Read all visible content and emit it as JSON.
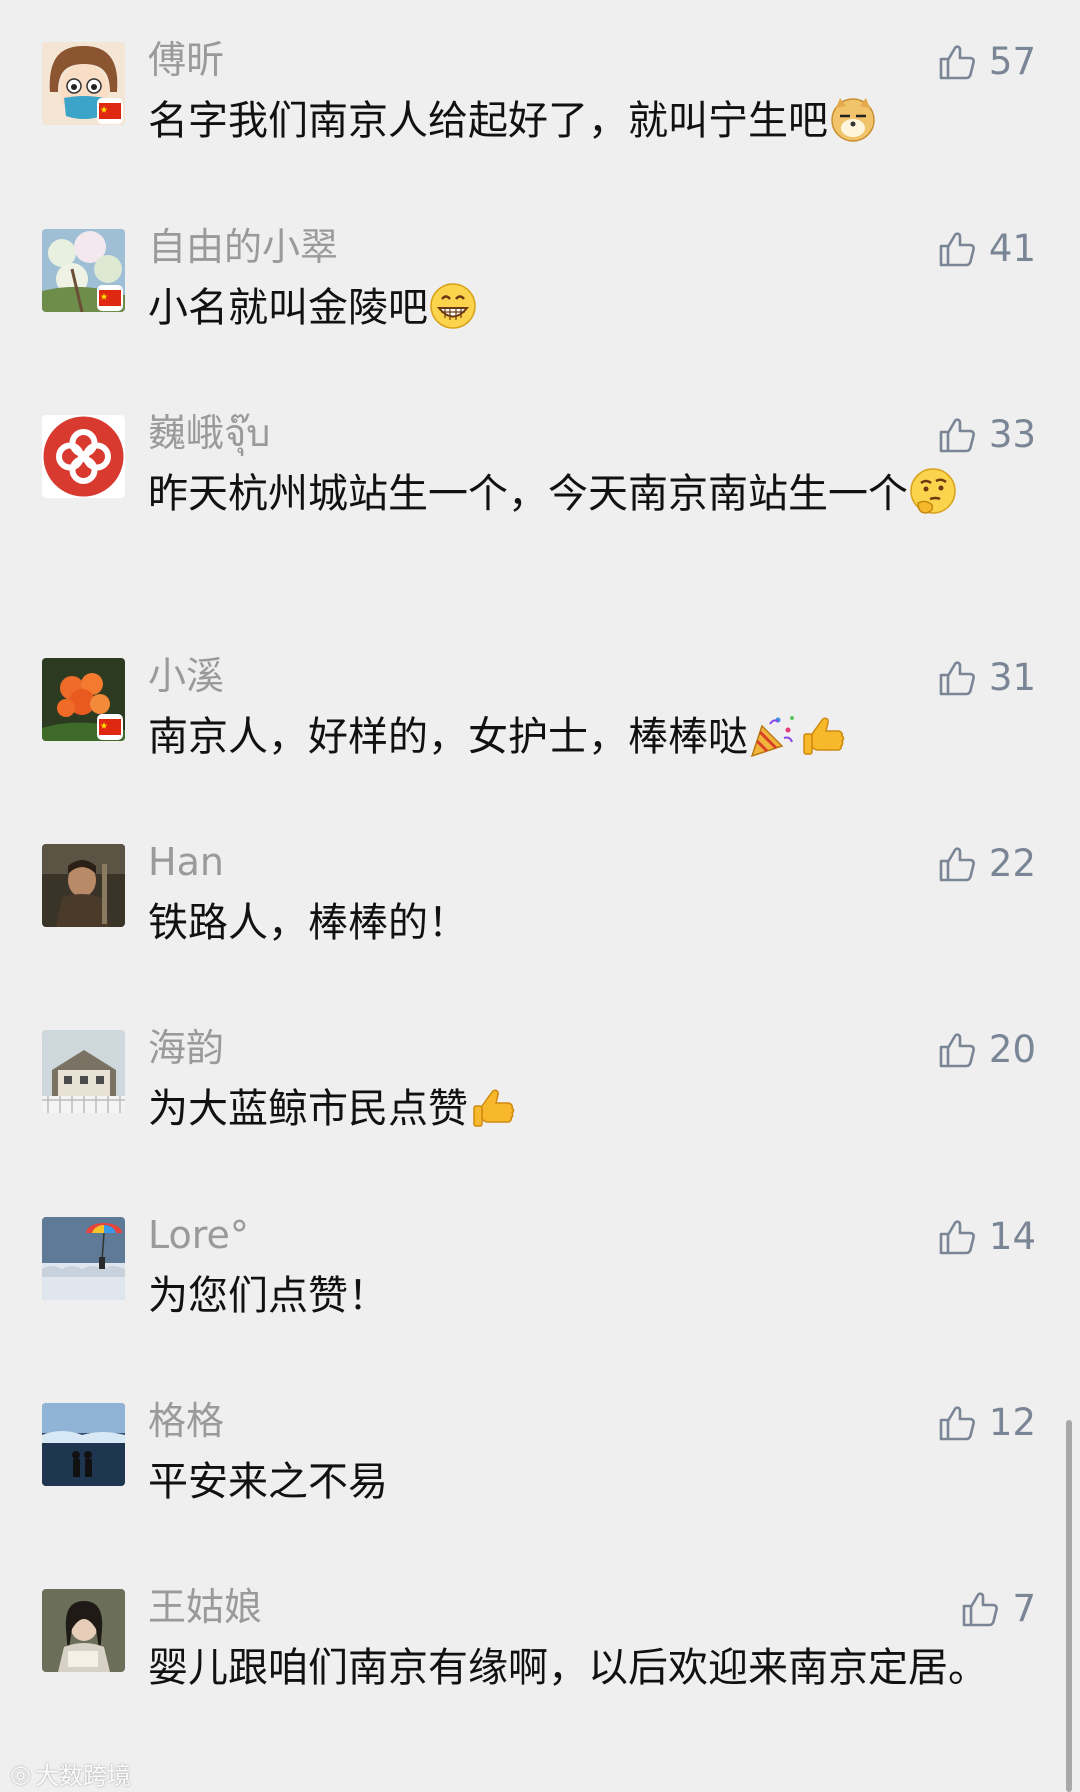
{
  "comments": [
    {
      "name": "傅昕",
      "likes": "57",
      "text": "名字我们南京人给起好了，就叫宁生吧",
      "emoji": "doge-emoji-icon"
    },
    {
      "name": "自由的小翠",
      "likes": "41",
      "text": "小名就叫金陵吧",
      "emoji": "grin-emoji-icon"
    },
    {
      "name": "巍峨จุ๊บ",
      "likes": "33",
      "text": "昨天杭州城站生一个，今天南京南站生一个",
      "emoji": "thinking-emoji-icon"
    },
    {
      "name": "小溪",
      "likes": "31",
      "text": "南京人，好样的，女护士，棒棒哒",
      "emoji": "party-popper-and-thumbs-up-emoji-icons"
    },
    {
      "name": "Han",
      "likes": "22",
      "text": "铁路人，棒棒的！"
    },
    {
      "name": "海韵",
      "likes": "20",
      "text": "为大蓝鲸市民点赞",
      "emoji": "thumbs-up-emoji-icon"
    },
    {
      "name": "Lore°",
      "likes": "14",
      "text": "为您们点赞！"
    },
    {
      "name": "格格",
      "likes": "12",
      "text": "平安来之不易"
    },
    {
      "name": "王姑娘",
      "likes": "7",
      "text": "婴儿跟咱们南京有缘啊，以后欢迎来南京定居。"
    }
  ],
  "watermark": "大数跨境",
  "colors": {
    "background": "#efefef",
    "name_text": "#9a9a9a",
    "like_icon": "#7a8595",
    "comment_text": "#111111"
  }
}
